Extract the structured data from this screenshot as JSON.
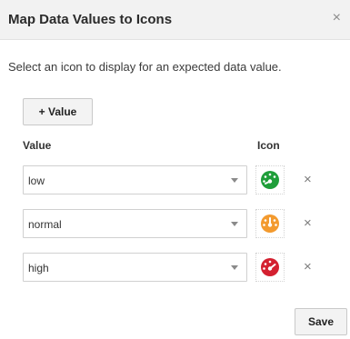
{
  "dialog": {
    "title": "Map Data Values to Icons",
    "close_glyph": "×",
    "description": "Select an icon to display for an expected data value.",
    "add_button_label": "+ Value",
    "columns": {
      "value": "Value",
      "icon": "Icon"
    },
    "rows": [
      {
        "value": "low",
        "icon": "gauge-low-icon",
        "color": "#1f9e3a"
      },
      {
        "value": "normal",
        "icon": "gauge-normal-icon",
        "color": "#f39a2e"
      },
      {
        "value": "high",
        "icon": "gauge-high-icon",
        "color": "#d42030"
      }
    ],
    "remove_glyph": "×",
    "save_label": "Save"
  }
}
